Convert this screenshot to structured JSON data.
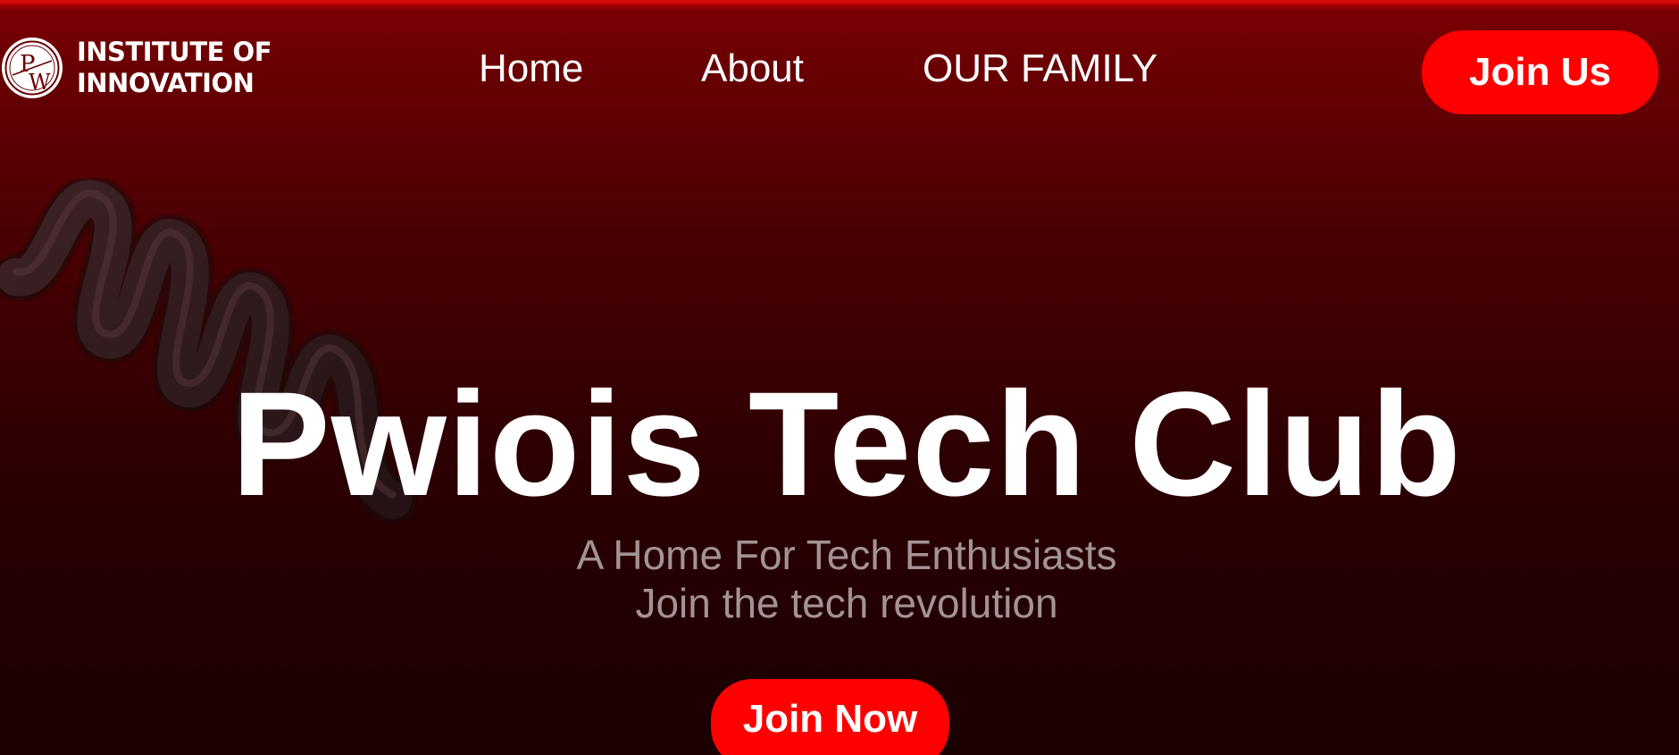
{
  "brand": {
    "logo_icon": "pw-circle-logo",
    "logo_monogram_top": "P",
    "logo_monogram_bottom": "W",
    "name_line1": "INSTITUTE OF",
    "name_line2": "INNOVATION"
  },
  "nav": {
    "items": [
      {
        "label": "Home"
      },
      {
        "label": "About"
      },
      {
        "label": "OUR FAMILY"
      }
    ],
    "cta_label": "Join Us"
  },
  "hero": {
    "decoration": "spring-coil-graphic",
    "title": "Pwiois Tech Club",
    "subtitle": "A Home For Tech Enthusiasts",
    "tagline": "Join the tech revolution",
    "cta_label": "Join Now"
  },
  "colors": {
    "accent": "#ff0000",
    "background_top": "#7a0004",
    "background_bottom": "#1a0001",
    "subtitle_text": "#a39394"
  }
}
